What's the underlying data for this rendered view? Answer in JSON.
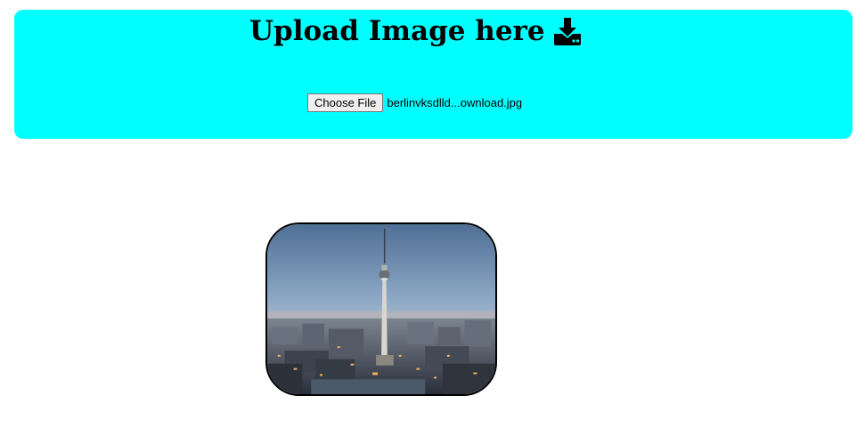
{
  "upload": {
    "title": "Upload Image here",
    "title_icon": "download-icon",
    "choose_button_label": "Choose File",
    "selected_file_name": "berlinvksdlld...ownload.jpg",
    "panel_color": "#00ffff"
  },
  "preview": {
    "image_subject": "berlin-tv-tower-cityscape"
  }
}
